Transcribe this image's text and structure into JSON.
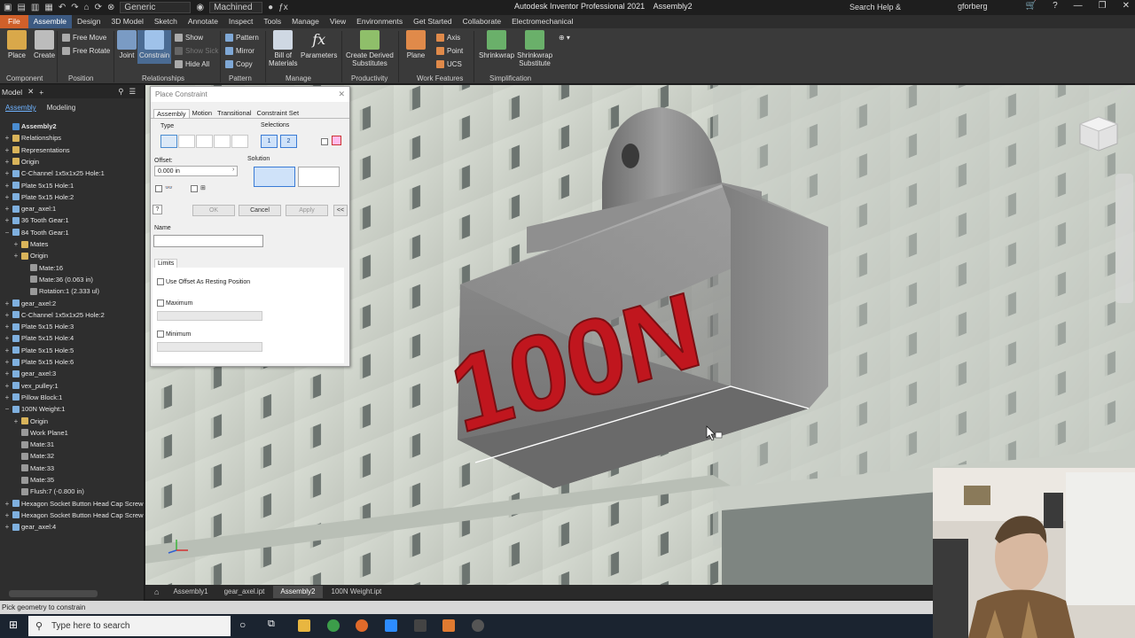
{
  "titlebar": {
    "appearance_combo": "Generic",
    "document_combo": "Machined",
    "app_title": "Autodesk Inventor Professional 2021",
    "doc_title": "Assembly2",
    "search_help": "Search Help & Commands...",
    "user": "gforberg"
  },
  "ribbon_tabs": [
    "File",
    "Assemble",
    "Design",
    "3D Model",
    "Sketch",
    "Annotate",
    "Inspect",
    "Tools",
    "Manage",
    "View",
    "Environments",
    "Get Started",
    "Collaborate",
    "Electromechanical"
  ],
  "ribbon": {
    "place": "Place",
    "create": "Create",
    "free_move": "Free Move",
    "free_rotate": "Free Rotate",
    "joint": "Joint",
    "constrain": "Constrain",
    "show": "Show",
    "show_sick": "Show Sick",
    "hide_all": "Hide All",
    "pattern": "Pattern",
    "mirror": "Mirror",
    "copy": "Copy",
    "bill_of": "Bill of",
    "materials": "Materials",
    "parameters": "Parameters",
    "create_derived": "Create Derived",
    "substitutes": "Substitutes",
    "plane": "Plane",
    "axis": "Axis",
    "point": "Point",
    "ucs": "UCS",
    "shrinkwrap": "Shrinkwrap",
    "shrinkwrap2": "Shrinkwrap",
    "substitute": "Substitute",
    "groups": {
      "component": "Component",
      "position": "Position",
      "relationships": "Relationships",
      "pattern": "Pattern",
      "manage": "Manage",
      "productivity": "Productivity",
      "work_features": "Work Features",
      "simplification": "Simplification"
    }
  },
  "browser": {
    "tab": "Model",
    "mode_assembly": "Assembly",
    "mode_modeling": "Modeling",
    "tree": [
      {
        "label": "Assembly2",
        "indent": 0,
        "icon": "asm",
        "tog": "",
        "bold": true
      },
      {
        "label": "Relationships",
        "indent": 0,
        "icon": "folder",
        "tog": "+"
      },
      {
        "label": "Representations",
        "indent": 0,
        "icon": "folder",
        "tog": "+"
      },
      {
        "label": "Origin",
        "indent": 0,
        "icon": "folder",
        "tog": "+"
      },
      {
        "label": "C-Channel 1x5x1x25 Hole:1",
        "indent": 0,
        "icon": "part",
        "tog": "+"
      },
      {
        "label": "Plate 5x15 Hole:1",
        "indent": 0,
        "icon": "part",
        "tog": "+"
      },
      {
        "label": "Plate 5x15 Hole:2",
        "indent": 0,
        "icon": "part",
        "tog": "+"
      },
      {
        "label": "gear_axel:1",
        "indent": 0,
        "icon": "part",
        "tog": "+"
      },
      {
        "label": "36 Tooth Gear:1",
        "indent": 0,
        "icon": "part",
        "tog": "+"
      },
      {
        "label": "84 Tooth Gear:1",
        "indent": 0,
        "icon": "part",
        "tog": "−"
      },
      {
        "label": "Mates",
        "indent": 1,
        "icon": "folder",
        "tog": "+"
      },
      {
        "label": "Origin",
        "indent": 1,
        "icon": "folder",
        "tog": "+"
      },
      {
        "label": "Mate:16",
        "indent": 2,
        "icon": "mate",
        "tog": ""
      },
      {
        "label": "Mate:36 (0.063 in)",
        "indent": 2,
        "icon": "mate",
        "tog": ""
      },
      {
        "label": "Rotation:1 (2.333 ul)",
        "indent": 2,
        "icon": "mate",
        "tog": ""
      },
      {
        "label": "gear_axel:2",
        "indent": 0,
        "icon": "part",
        "tog": "+"
      },
      {
        "label": "C-Channel 1x5x1x25 Hole:2",
        "indent": 0,
        "icon": "part",
        "tog": "+"
      },
      {
        "label": "Plate 5x15 Hole:3",
        "indent": 0,
        "icon": "part",
        "tog": "+"
      },
      {
        "label": "Plate 5x15 Hole:4",
        "indent": 0,
        "icon": "part",
        "tog": "+"
      },
      {
        "label": "Plate 5x15 Hole:5",
        "indent": 0,
        "icon": "part",
        "tog": "+"
      },
      {
        "label": "Plate 5x15 Hole:6",
        "indent": 0,
        "icon": "part",
        "tog": "+"
      },
      {
        "label": "gear_axel:3",
        "indent": 0,
        "icon": "part",
        "tog": "+"
      },
      {
        "label": "vex_pulley:1",
        "indent": 0,
        "icon": "part",
        "tog": "+"
      },
      {
        "label": "Pillow Block:1",
        "indent": 0,
        "icon": "part",
        "tog": "+"
      },
      {
        "label": "100N Weight:1",
        "indent": 0,
        "icon": "part",
        "tog": "−"
      },
      {
        "label": "Origin",
        "indent": 1,
        "icon": "folder",
        "tog": "+"
      },
      {
        "label": "Work Plane1",
        "indent": 1,
        "icon": "mate",
        "tog": ""
      },
      {
        "label": "Mate:31",
        "indent": 1,
        "icon": "mate",
        "tog": ""
      },
      {
        "label": "Mate:32",
        "indent": 1,
        "icon": "mate",
        "tog": ""
      },
      {
        "label": "Mate:33",
        "indent": 1,
        "icon": "mate",
        "tog": ""
      },
      {
        "label": "Mate:35",
        "indent": 1,
        "icon": "mate",
        "tog": ""
      },
      {
        "label": "Flush:7 (-0.800 in)",
        "indent": 1,
        "icon": "mate",
        "tog": ""
      },
      {
        "label": "Hexagon Socket Button Head Cap Screw -",
        "indent": 0,
        "icon": "part",
        "tog": "+"
      },
      {
        "label": "Hexagon Socket Button Head Cap Screw -",
        "indent": 0,
        "icon": "part",
        "tog": "+"
      },
      {
        "label": "gear_axel:4",
        "indent": 0,
        "icon": "part",
        "tog": "+"
      }
    ]
  },
  "dialog": {
    "title": "Place Constraint",
    "tabs": [
      "Assembly",
      "Motion",
      "Transitional",
      "Constraint Set"
    ],
    "type_label": "Type",
    "selections_label": "Selections",
    "sel1": "1",
    "sel2": "2",
    "offset_label": "Offset:",
    "offset_value": "0.000 in",
    "solution_label": "Solution",
    "ok": "OK",
    "cancel": "Cancel",
    "apply": "Apply",
    "collapse": "<<",
    "name_label": "Name",
    "limits_tab": "Limits",
    "use_offset": "Use Offset As Resting Position",
    "maximum": "Maximum",
    "minimum": "Minimum"
  },
  "scene": {
    "weight_text": "100N"
  },
  "doctabs": [
    "Assembly1",
    "gear_axel.ipt",
    "Assembly2",
    "100N Weight.ipt"
  ],
  "statusbar": "Pick geometry to constrain",
  "taskbar": {
    "search_placeholder": "Type here to search"
  },
  "colors": {
    "accent_tab": "#3c5a82",
    "file_tab": "#d0602a",
    "weight_text": "#c0161e",
    "plate": "#d7dcd3"
  }
}
